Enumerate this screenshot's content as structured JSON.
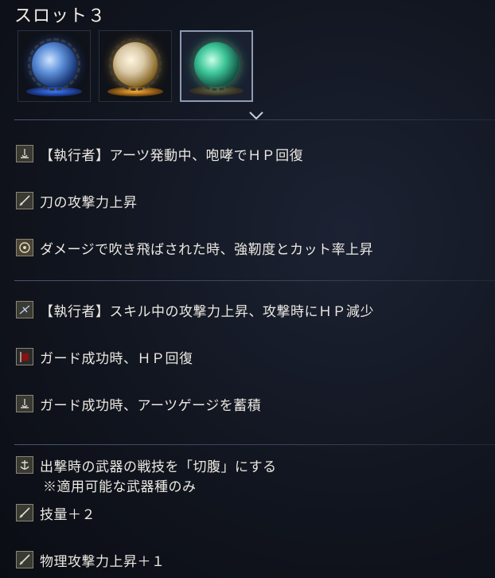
{
  "header": {
    "title": "スロット３"
  },
  "slots": [
    {
      "name": "blue-relic",
      "color": "#5d8fd8",
      "selected": false
    },
    {
      "name": "gold-relic",
      "color": "#d9c9a8",
      "selected": false
    },
    {
      "name": "green-relic",
      "color": "#3fc79a",
      "selected": true
    }
  ],
  "effects": [
    {
      "icon": "arts-icon",
      "text": "【執行者】アーツ発動中、咆哮でＨＰ回復"
    },
    {
      "icon": "sword-icon",
      "text": "刀の攻撃力上昇"
    },
    {
      "icon": "shield-crest-icon",
      "text": "ダメージで吹き飛ばされた時、強靭度とカット率上昇"
    },
    {
      "icon": "skill-icon",
      "text": "【執行者】スキル中の攻撃力上昇、攻撃時にＨＰ減少"
    },
    {
      "icon": "red-flag-icon",
      "text": "ガード成功時、ＨＰ回復"
    },
    {
      "icon": "arts-icon",
      "text": "ガード成功時、アーツゲージを蓄積"
    },
    {
      "icon": "anchor-icon",
      "text": "出撃時の武器の戦技を「切腹」にする",
      "note": "※適用可能な武器種のみ"
    },
    {
      "icon": "sword-icon",
      "text": "技量＋２"
    },
    {
      "icon": "sword-icon",
      "text": "物理攻撃力上昇＋１"
    }
  ]
}
